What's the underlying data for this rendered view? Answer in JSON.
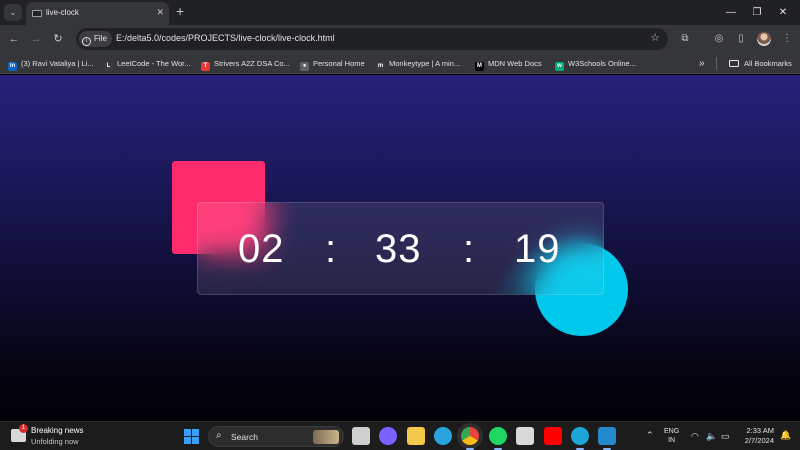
{
  "browser": {
    "tab": {
      "title": "live-clock",
      "close": "✕"
    },
    "new_tab": "+",
    "window": {
      "minimize": "—",
      "restore": "❐",
      "close": "✕"
    },
    "toolbar": {
      "back": "←",
      "forward": "→",
      "reload": "↻",
      "site_chip": "File",
      "url": "E:/delta5.0/codes/PROJECTS/live-clock/live-clock.html",
      "bookmark_star": "☆"
    },
    "bookmarks": [
      {
        "label": "(3) Ravi Vataliya | Li...",
        "icon": "linkedin-icon",
        "glyph": "in",
        "color": "#0a66c2"
      },
      {
        "label": "LeetCode - The Wor...",
        "icon": "leetcode-icon",
        "glyph": "L",
        "color": "#3b3b3b"
      },
      {
        "label": "Strivers A2Z DSA Co...",
        "icon": "tuf-icon",
        "glyph": "T",
        "color": "#e53935"
      },
      {
        "label": "Personal Home",
        "icon": "person-icon",
        "glyph": "●",
        "color": "#5f6368"
      },
      {
        "label": "Monkeytype | A min...",
        "icon": "monkeytype-icon",
        "glyph": "m",
        "color": "#3b3b3b"
      },
      {
        "label": "MDN Web Docs",
        "icon": "mdn-icon",
        "glyph": "M",
        "color": "#000000"
      },
      {
        "label": "W3Schools Online...",
        "icon": "w3schools-icon",
        "glyph": "w",
        "color": "#04aa6d"
      }
    ],
    "bookmarks_more": "»",
    "all_bookmarks": "All Bookmarks"
  },
  "clock": {
    "hours": "02",
    "minutes": "33",
    "seconds": "19",
    "separator": ":"
  },
  "taskbar": {
    "news": {
      "title": "Breaking news",
      "subtitle": "Unfolding now",
      "badge": "1"
    },
    "search_label": "Search",
    "apps": [
      {
        "name": "taskview-icon",
        "color": "#cfcfcf"
      },
      {
        "name": "meet-icon",
        "color": "#7b61ff"
      },
      {
        "name": "file-explorer-icon",
        "color": "#f2c94c"
      },
      {
        "name": "telegram-icon",
        "color": "#2aa3df"
      },
      {
        "name": "chrome-icon",
        "color": "#e8453c"
      },
      {
        "name": "spotify-icon",
        "color": "#1ed760"
      },
      {
        "name": "store-icon",
        "color": "#d9d9d9"
      },
      {
        "name": "youtube-icon",
        "color": "#ff0000"
      },
      {
        "name": "edge-icon",
        "color": "#1da4d8"
      },
      {
        "name": "vscode-icon",
        "color": "#2489ca"
      }
    ],
    "tray": {
      "language_line1": "ENG",
      "language_line2": "IN",
      "time": "2:33 AM",
      "date": "2/7/2024"
    }
  },
  "colors": {
    "square": "#ff2c6d",
    "circle": "#00c8ea",
    "page_gradient_top": "#27207a",
    "page_gradient_bottom": "#020208"
  }
}
